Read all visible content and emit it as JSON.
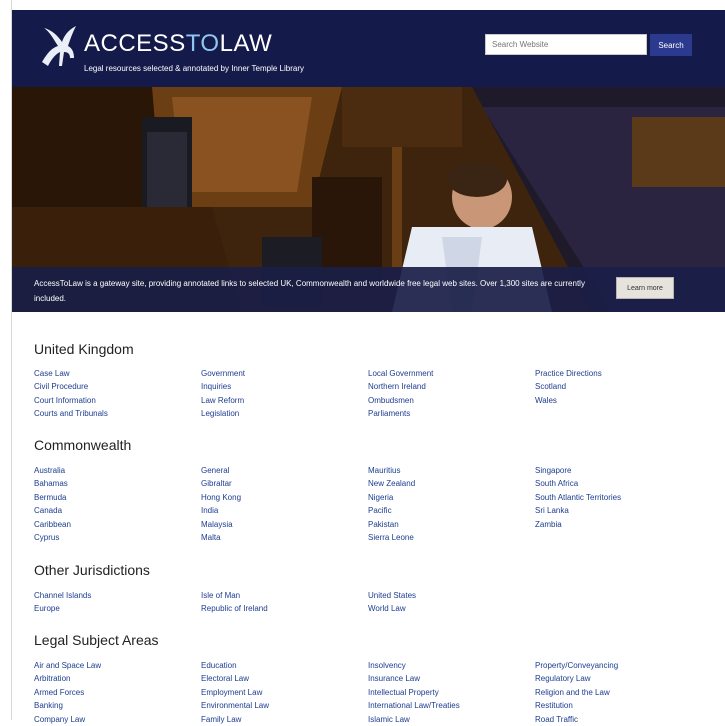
{
  "header": {
    "logo_main": "ACCESS",
    "logo_accent": "TO",
    "logo_end": "LAW",
    "tagline": "Legal resources selected & annotated by Inner Temple Library",
    "search_placeholder": "Search Website",
    "search_button": "Search"
  },
  "hero": {
    "text": "AccessToLaw is a gateway site, providing annotated links to selected UK, Commonwealth and worldwide free legal web sites. Over 1,300 sites are currently included.",
    "button": "Learn more"
  },
  "sections": {
    "uk": {
      "title": "United Kingdom",
      "columns": [
        [
          "Case Law",
          "Civil Procedure",
          "Court Information",
          "Courts and Tribunals"
        ],
        [
          "Government",
          "Inquiries",
          "Law Reform",
          "Legislation"
        ],
        [
          "Local Government",
          "Northern Ireland",
          "Ombudsmen",
          "Parliaments"
        ],
        [
          "Practice Directions",
          "Scotland",
          "Wales"
        ]
      ]
    },
    "commonwealth": {
      "title": "Commonwealth",
      "columns": [
        [
          "Australia",
          "Bahamas",
          "Bermuda",
          "Canada",
          "Caribbean",
          "Cyprus"
        ],
        [
          "General",
          "Gibraltar",
          "Hong Kong",
          "India",
          "Malaysia",
          "Malta"
        ],
        [
          "Mauritius",
          "New Zealand",
          "Nigeria",
          "Pacific",
          "Pakistan",
          "Sierra Leone"
        ],
        [
          "Singapore",
          "South Africa",
          "South Atlantic Territories",
          "Sri Lanka",
          "Zambia"
        ]
      ]
    },
    "other": {
      "title": "Other Jurisdictions",
      "columns": [
        [
          "Channel Islands",
          "Europe"
        ],
        [
          "Isle of Man",
          "Republic of Ireland"
        ],
        [
          "United States",
          "World Law"
        ],
        []
      ]
    },
    "subjects": {
      "title": "Legal Subject Areas",
      "columns": [
        [
          "Air and Space Law",
          "Arbitration",
          "Armed Forces",
          "Banking",
          "Company Law"
        ],
        [
          "Education",
          "Electoral Law",
          "Employment Law",
          "Environmental Law",
          "Family Law"
        ],
        [
          "Insolvency",
          "Insurance Law",
          "Intellectual Property",
          "International Law/Treaties",
          "Islamic Law"
        ],
        [
          "Property/Conveyancing",
          "Regulatory Law",
          "Religion and the Law",
          "Restitution",
          "Road Traffic"
        ]
      ]
    }
  },
  "colors": {
    "header_bg": "#141a4a",
    "link": "#1d3d8f",
    "button_blue": "#2b3a8f"
  }
}
